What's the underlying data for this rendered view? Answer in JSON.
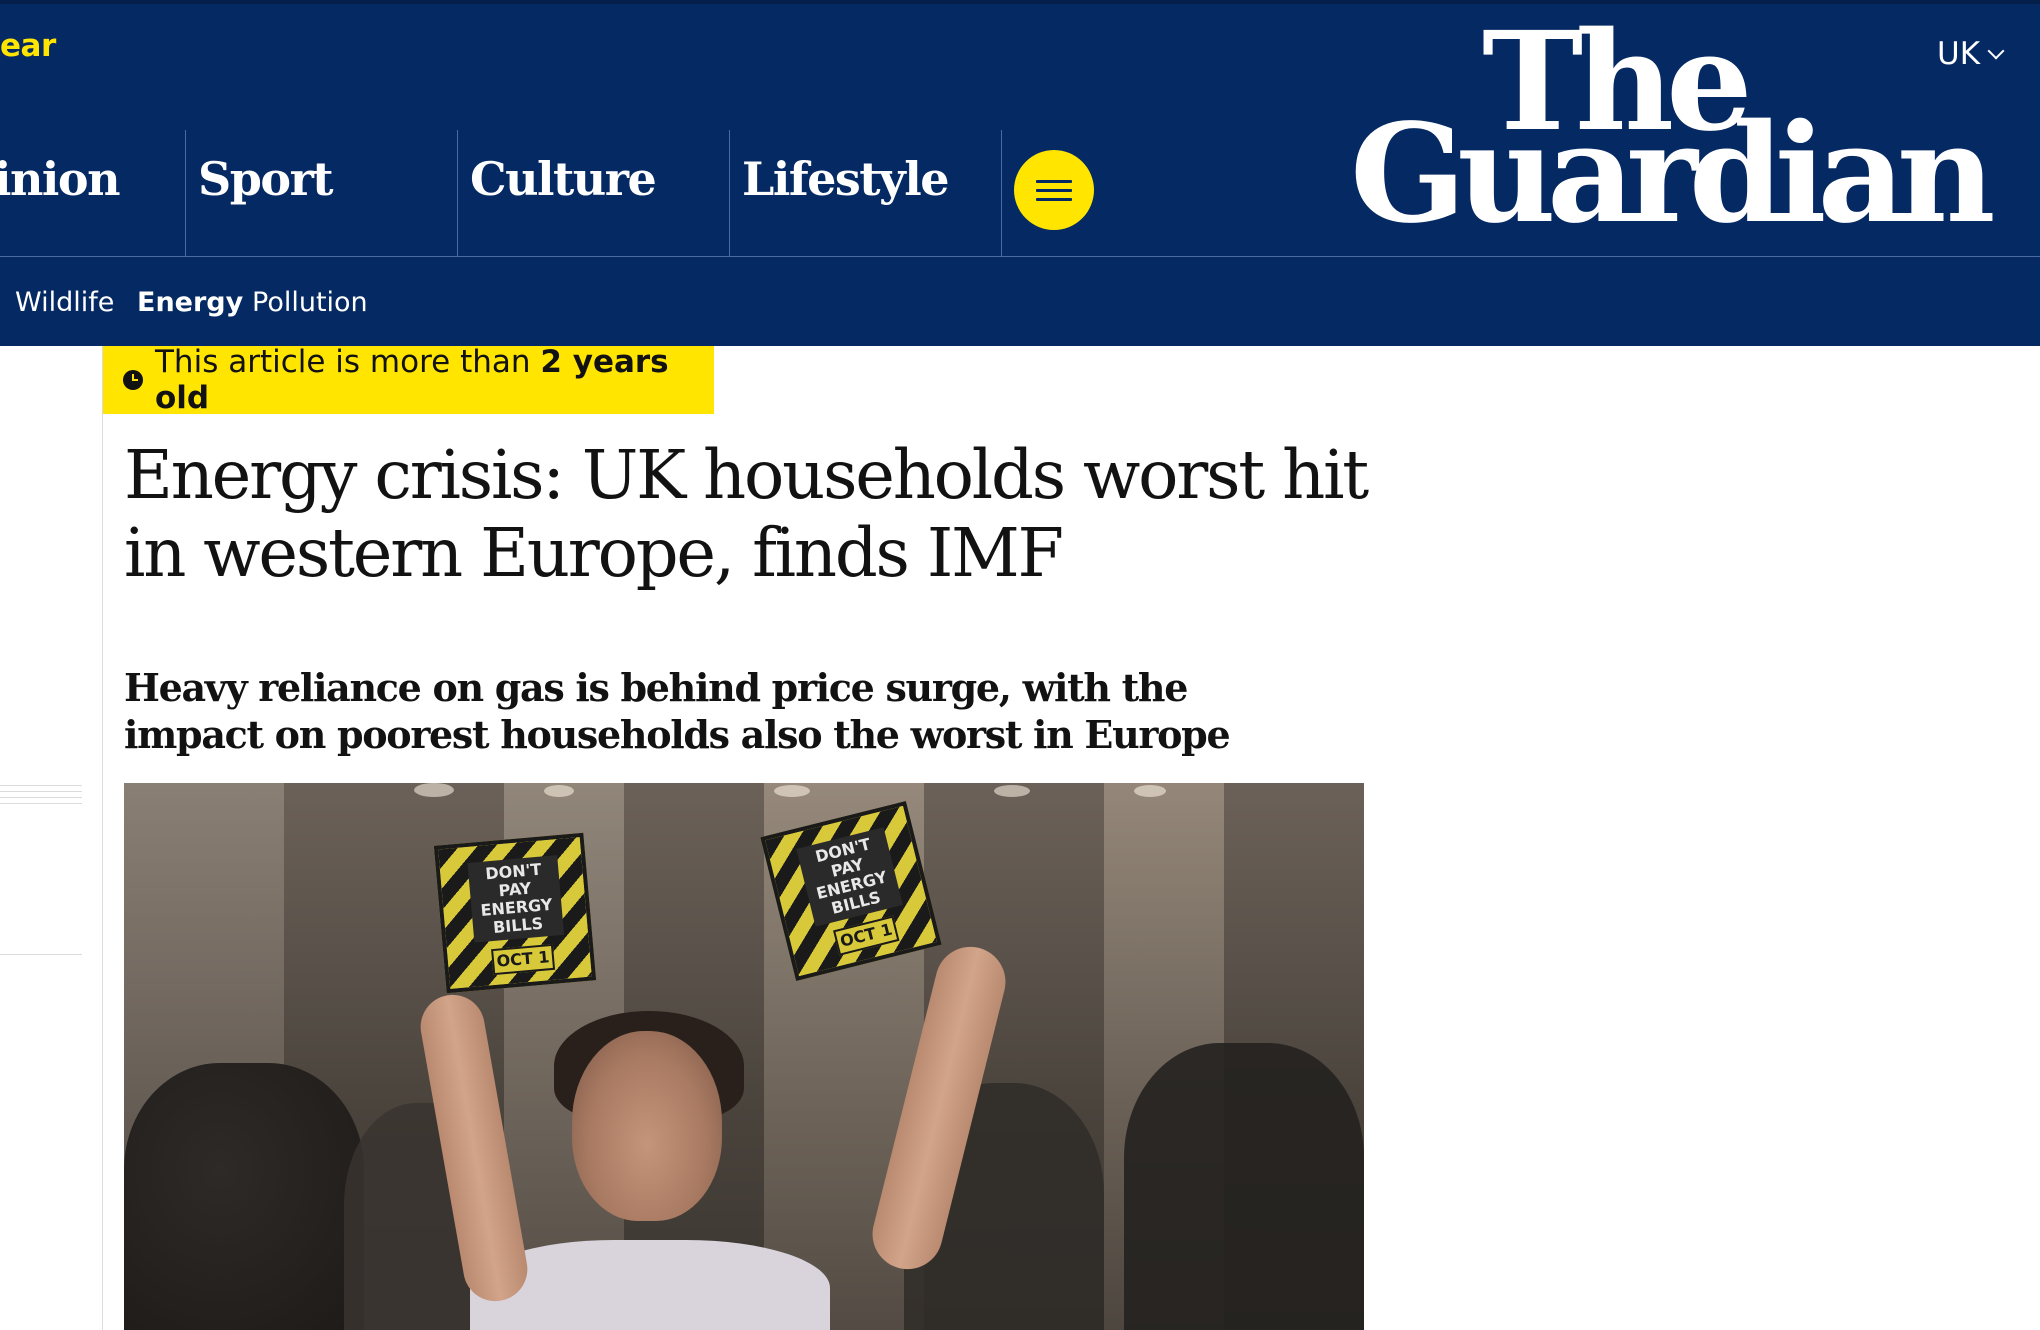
{
  "header": {
    "support_link": "ear",
    "edition": "UK",
    "logo_line1": "The",
    "logo_line2": "Guardian",
    "pillars": [
      "inion",
      "Sport",
      "Culture",
      "Lifestyle"
    ],
    "menu_icon": "hamburger-menu-icon",
    "subnav": [
      {
        "label": "Wildlife",
        "active": false
      },
      {
        "label": "Energy",
        "active": true
      },
      {
        "label": "Pollution",
        "active": false
      }
    ]
  },
  "article": {
    "age_notice_prefix": "This article is more than ",
    "age_notice_bold": "2 years old",
    "headline": "Energy crisis: UK households worst hit in western Europe, finds IMF",
    "standfirst": "Heavy reliance on gas is behind price surge, with the impact on poorest households also the worst in Europe",
    "photo": {
      "sign_text": "DON'T PAY ENERGY BILLS",
      "sign_date": "OCT 1"
    }
  },
  "colors": {
    "brand_blue": "#052962",
    "accent_yellow": "#ffe500",
    "text": "#121212"
  }
}
